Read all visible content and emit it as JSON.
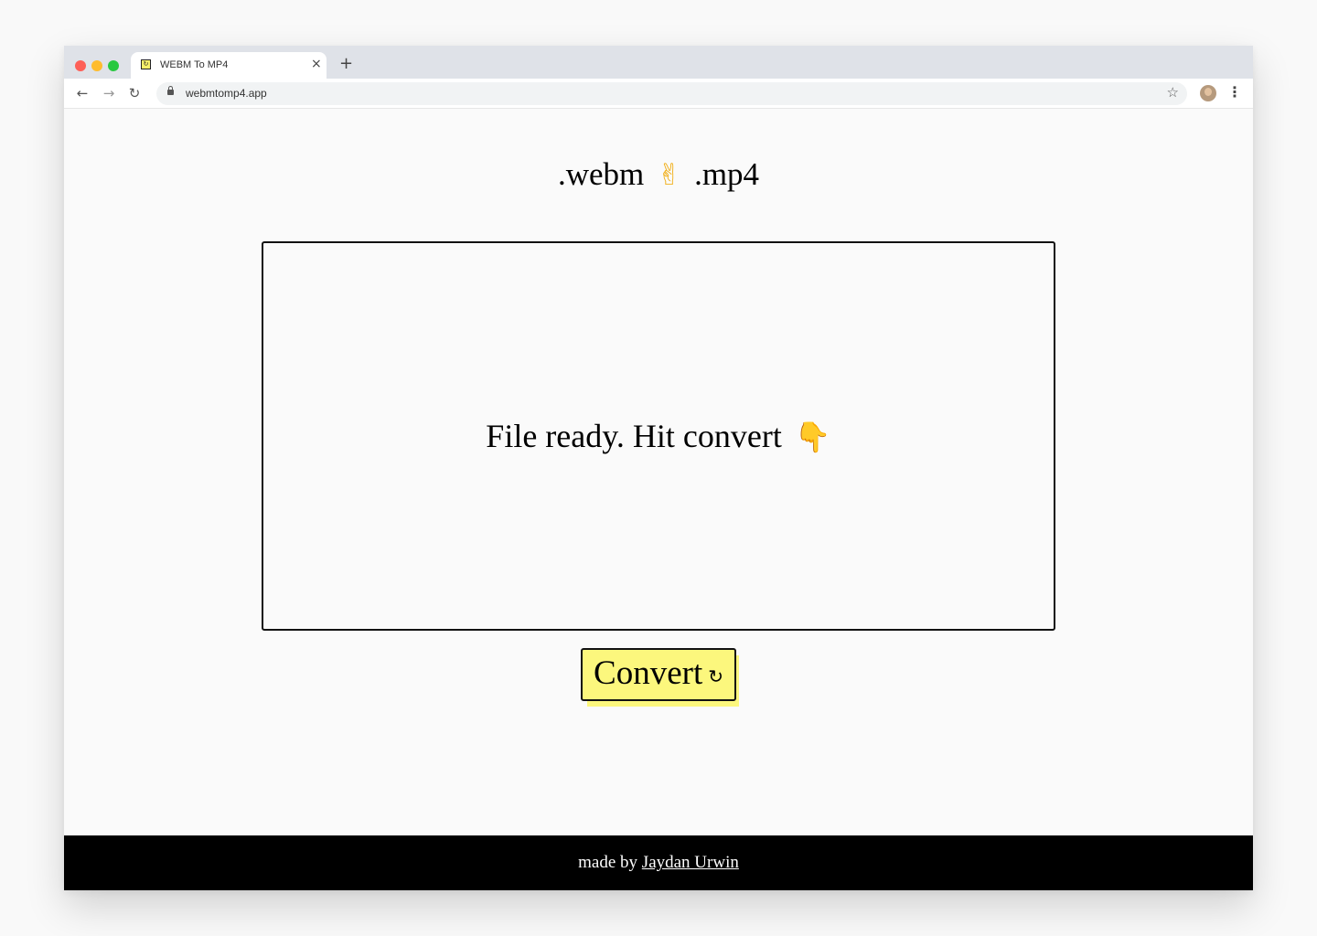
{
  "browser": {
    "tab": {
      "title": "WEBM To MP4",
      "favicon": "↻",
      "close": "×"
    },
    "new_tab": "+",
    "nav": {
      "back": "←",
      "forward": "→",
      "reload": "↻"
    },
    "url": "webmtomp4.app",
    "star": "☆",
    "menu": "⋮"
  },
  "page": {
    "logo": {
      "left": ".webm",
      "emoji": "✌",
      "right": ".mp4"
    },
    "dropzone": {
      "message": "File ready. Hit convert",
      "emoji": "👇"
    },
    "convert": {
      "label": "Convert",
      "icon": "↻"
    },
    "footer": {
      "prefix": "made by ",
      "author": "Jaydan Urwin"
    }
  },
  "colors": {
    "accent": "#fcf77d",
    "footer_bg": "#000000",
    "emoji": "#f1b01c"
  }
}
